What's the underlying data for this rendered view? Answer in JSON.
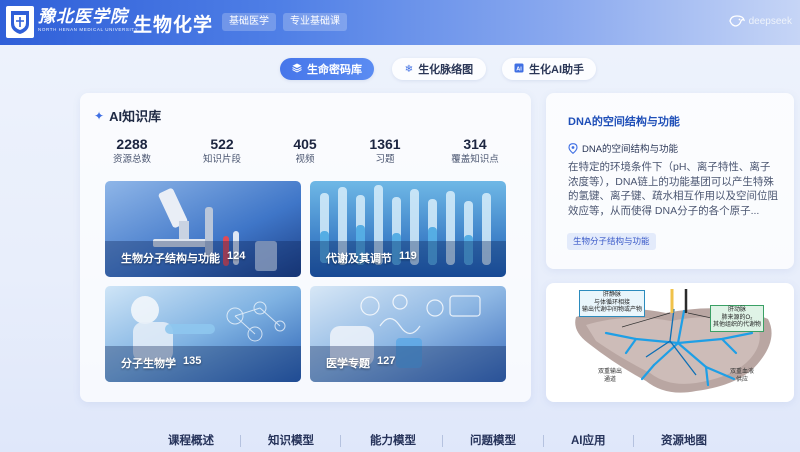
{
  "header": {
    "school_name": "豫北医学院",
    "school_en": "NORTH HENAN MEDICAL UNIVERSITY",
    "app_title": "生物化学",
    "tags": [
      "基础医学",
      "专业基础课"
    ],
    "brand": "deepseek"
  },
  "tabs": [
    {
      "label": "生命密码库",
      "icon": "cube-icon",
      "active": true
    },
    {
      "label": "生化脉络图",
      "icon": "snowflake-icon",
      "active": false
    },
    {
      "label": "生化AI助手",
      "icon": "ai-icon",
      "active": false
    }
  ],
  "knowledge": {
    "title": "AI知识库",
    "stats": [
      {
        "value": "2288",
        "label": "资源总数"
      },
      {
        "value": "522",
        "label": "知识片段"
      },
      {
        "value": "405",
        "label": "视频"
      },
      {
        "value": "1361",
        "label": "习题"
      },
      {
        "value": "314",
        "label": "覆盖知识点"
      }
    ],
    "cards": [
      {
        "name": "生物分子结构与功能",
        "count": "124"
      },
      {
        "name": "代谢及其调节",
        "count": "119"
      },
      {
        "name": "分子生物学",
        "count": "135"
      },
      {
        "name": "医学专题",
        "count": "127"
      }
    ]
  },
  "detail": {
    "title": "DNA的空间结构与功能",
    "subtitle": "DNA的空间结构与功能",
    "body": "在特定的环境条件下（pH、离子特性、离子浓度等），DNA链上的功能基团可以产生特殊的氢键、离子键、疏水相互作用以及空间位阻效应等，从而使得 DNA分子的各个原子...",
    "tag": "生物分子结构与功能"
  },
  "illustration": {
    "callout_left": [
      "肝静脉",
      "与体循环相接",
      "输出代谢中间物或产物"
    ],
    "callout_right": [
      "肝动脉",
      "肺来源的O₂",
      "其他组织的代谢物"
    ],
    "label_bottom_left": [
      "双重输出",
      "通道"
    ],
    "label_bottom_right": [
      "双重血液",
      "供应"
    ]
  },
  "bottom_nav": [
    "课程概述",
    "知识模型",
    "能力模型",
    "问题模型",
    "AI应用",
    "资源地图"
  ],
  "colors": {
    "primary": "#3f6fe3",
    "header_start": "#2f5fd8",
    "tab_active": "#4676ea",
    "detail_title": "#1f4fb8"
  }
}
